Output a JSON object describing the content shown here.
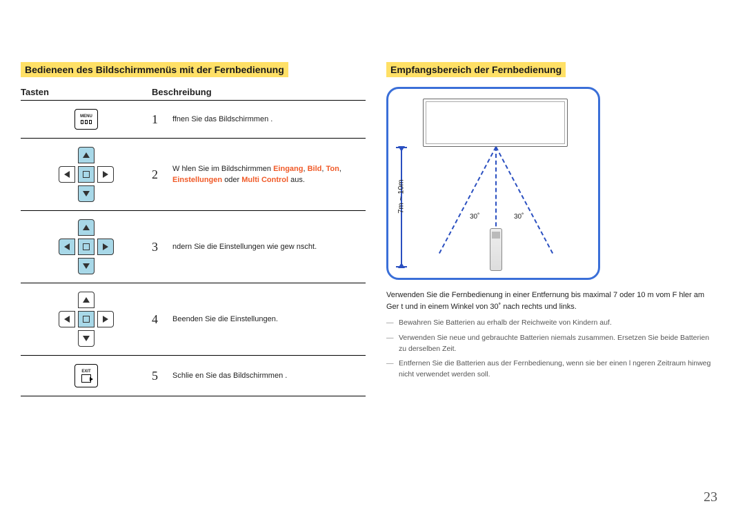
{
  "left": {
    "title": "Bedieneen des Bildschirmmenüs mit der Fernbedienung",
    "col_tasten": "Tasten",
    "col_besch": "Beschreibung",
    "rows": [
      {
        "num": "1",
        "text_a": "  ffnen Sie das Bildschirmmen ."
      },
      {
        "num": "2",
        "text_a": "W hlen Sie im Bildschirmmen  ",
        "hl1": "Eingang",
        "sep1": ", ",
        "hl2": "Bild",
        "sep2": ", ",
        "hl3": "Ton",
        "sep3": ", ",
        "hl4": "Einstellungen",
        "mid": " oder ",
        "hl5": "Multi Control",
        "text_b": " aus."
      },
      {
        "num": "3",
        "text_a": "  ndern Sie die Einstellungen wie gew nscht."
      },
      {
        "num": "4",
        "text_a": "Beenden Sie die Einstellungen."
      },
      {
        "num": "5",
        "text_a": "Schlie en Sie das Bildschirmmen ."
      }
    ],
    "menu_label": "MENU",
    "exit_label": "EXIT"
  },
  "right": {
    "title": "Empfangsbereich der Fernbedienung",
    "distance": "7m ~ 10m",
    "angle_left": "30˚",
    "angle_right": "30˚",
    "body": "Verwenden Sie die Fernbedienung in einer Entfernung bis maximal 7 oder 10 m vom F hler am Ger t und in einem Winkel von 30˚ nach rechts und links.",
    "notes": [
      "Bewahren Sie Batterien au erhalb der Reichweite von Kindern auf.",
      "Verwenden Sie neue und gebrauchte Batterien niemals zusammen. Ersetzen Sie beide Batterien zu derselben Zeit.",
      "Entfernen Sie die Batterien aus der Fernbedienung, wenn sie  ber einen l ngeren Zeitraum hinweg nicht verwendet werden soll."
    ]
  },
  "page_number": "23"
}
